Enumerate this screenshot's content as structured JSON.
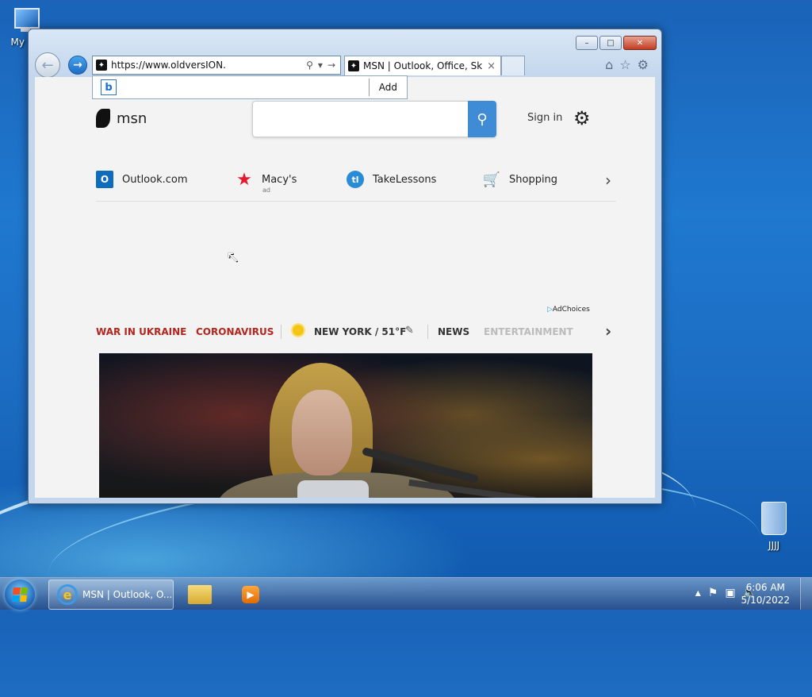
{
  "desktop": {
    "my_computer_label": "My Co",
    "recycle_label": "JJJJ"
  },
  "window": {
    "minimize_glyph": "–",
    "maximize_glyph": "□",
    "close_glyph": "✕"
  },
  "toolbar": {
    "address_url": "https://www.oldversION.",
    "tab_title": "MSN | Outlook, Office, Sky...",
    "tab_close": "×",
    "add_label": "Add"
  },
  "msn": {
    "logo_text": "msn",
    "sign_in": "Sign in",
    "quick_links": [
      {
        "label": "Outlook.com",
        "icon": "outlook-icon"
      },
      {
        "label": "Macy's",
        "sub": "ad",
        "icon": "macys-star-icon"
      },
      {
        "label": "TakeLessons",
        "icon": "takelessons-icon"
      },
      {
        "label": "Shopping",
        "icon": "cart-icon"
      }
    ],
    "adchoices": "AdChoices",
    "topics": {
      "war": "WAR IN UKRAINE",
      "corona": "CORONAVIRUS",
      "weather": "NEW YORK / 51°F",
      "news": "NEWS",
      "entertainment": "ENTERTAINMENT"
    }
  },
  "taskbar": {
    "ie_label": "MSN | Outlook, O...",
    "time": "6:06 AM",
    "date": "5/10/2022"
  }
}
